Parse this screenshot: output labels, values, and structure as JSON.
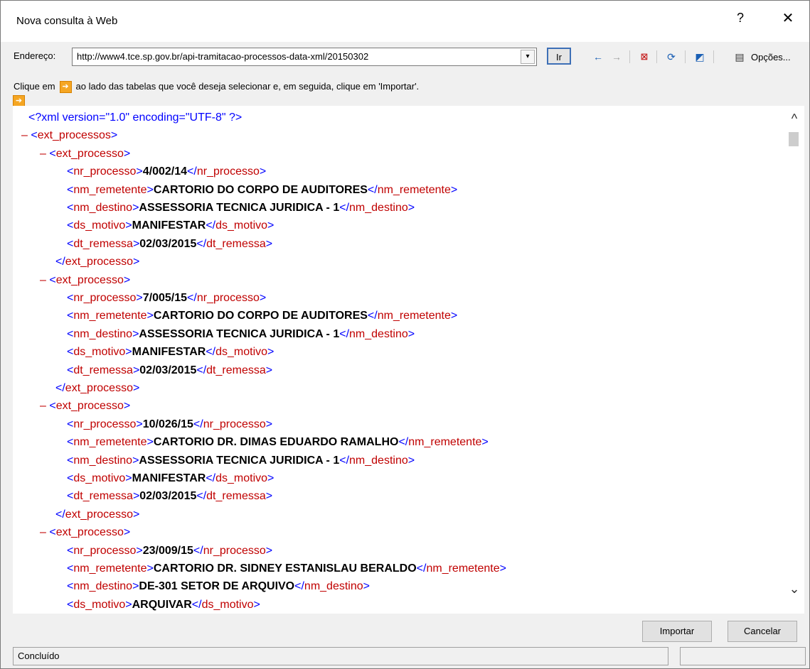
{
  "window": {
    "title": "Nova consulta à Web",
    "help": "?",
    "close": "✕"
  },
  "address": {
    "label": "Endereço:",
    "url": "http://www4.tce.sp.gov.br/api-tramitacao-processos-data-xml/20150302",
    "go": "Ir",
    "options": "Opções..."
  },
  "hint": {
    "before": "Clique em",
    "after": "ao lado das tabelas que você deseja selecionar e, em seguida, clique em 'Importar'."
  },
  "xml": {
    "declaration": "<?xml version=\"1.0\" encoding=\"UTF-8\" ?>",
    "root": "ext_processos",
    "item": "ext_processo",
    "processes": [
      {
        "nr_processo": "4/002/14",
        "nm_remetente": "CARTORIO DO CORPO DE AUDITORES",
        "nm_destino": "ASSESSORIA TECNICA JURIDICA - 1",
        "ds_motivo": "MANIFESTAR",
        "dt_remessa": "02/03/2015"
      },
      {
        "nr_processo": "7/005/15",
        "nm_remetente": "CARTORIO DO CORPO DE AUDITORES",
        "nm_destino": "ASSESSORIA TECNICA JURIDICA - 1",
        "ds_motivo": "MANIFESTAR",
        "dt_remessa": "02/03/2015"
      },
      {
        "nr_processo": "10/026/15",
        "nm_remetente": "CARTORIO DR. DIMAS EDUARDO RAMALHO",
        "nm_destino": "ASSESSORIA TECNICA JURIDICA - 1",
        "ds_motivo": "MANIFESTAR",
        "dt_remessa": "02/03/2015"
      },
      {
        "nr_processo": "23/009/15",
        "nm_remetente": "CARTORIO DR. SIDNEY ESTANISLAU BERALDO",
        "nm_destino": "DE-301 SETOR DE ARQUIVO",
        "ds_motivo": "ARQUIVAR"
      }
    ]
  },
  "buttons": {
    "import": "Importar",
    "cancel": "Cancelar"
  },
  "status": {
    "text": "Concluído"
  }
}
